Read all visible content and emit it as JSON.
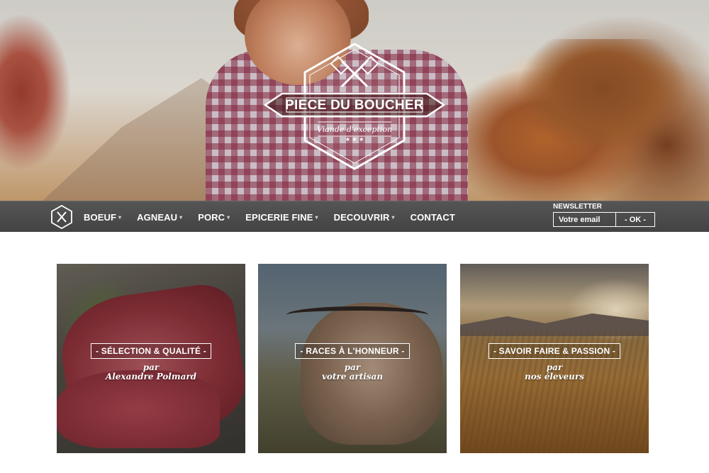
{
  "brand": {
    "name": "PIECE DU BOUCHER",
    "tagline": "Viande d'exception",
    "stars": "★ ★ ★"
  },
  "nav": {
    "items": [
      {
        "label": "BOEUF",
        "dropdown": true
      },
      {
        "label": "AGNEAU",
        "dropdown": true
      },
      {
        "label": "PORC",
        "dropdown": true
      },
      {
        "label": "EPICERIE FINE",
        "dropdown": true
      },
      {
        "label": "DECOUVRIR",
        "dropdown": true
      },
      {
        "label": "CONTACT",
        "dropdown": false
      }
    ],
    "caret": "▾"
  },
  "newsletter": {
    "label": "NEWSLETTER",
    "placeholder": "Votre email",
    "button": "- OK -"
  },
  "cards": [
    {
      "title": "- SÉLECTION & QUALITÉ -",
      "sub1": "par",
      "sub2": "Alexandre Polmard"
    },
    {
      "title": "- RACES À L'HONNEUR -",
      "sub1": "par",
      "sub2": "votre artisan"
    },
    {
      "title": "- SAVOIR FAIRE & PASSION -",
      "sub1": "par",
      "sub2": "nos éleveurs"
    }
  ],
  "colors": {
    "navbar": "#4b4b4c",
    "text_light": "#ffffff",
    "page_background": "#ffffff"
  }
}
